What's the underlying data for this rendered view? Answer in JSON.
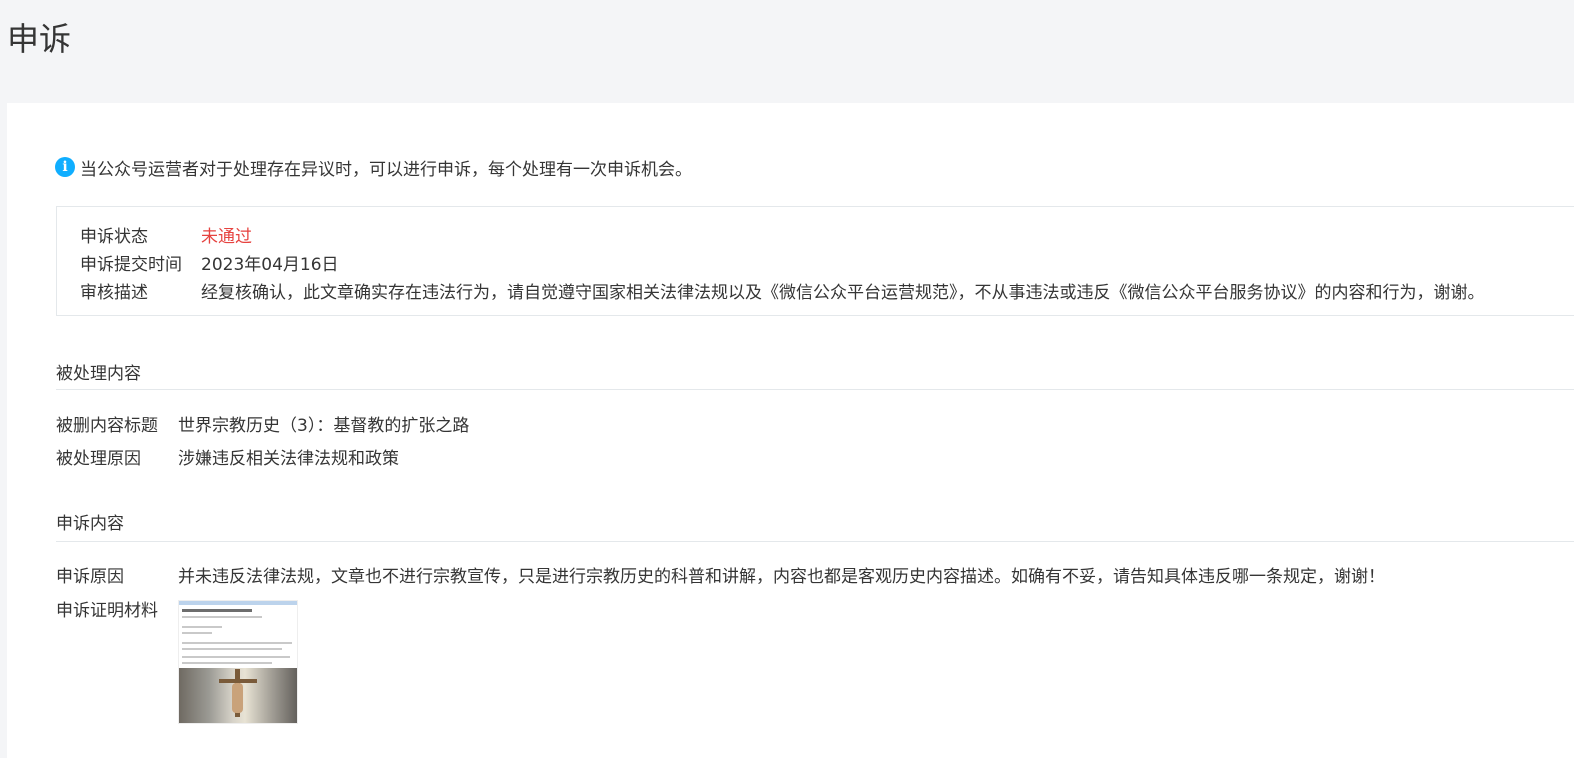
{
  "page": {
    "title": "申诉"
  },
  "notice": {
    "icon": "info-icon",
    "text": "当公众号运营者对于处理存在异议时，可以进行申诉，每个处理有一次申诉机会。"
  },
  "status": {
    "status_label": "申诉状态",
    "status_value": "未通过",
    "status_color": "#e64340",
    "time_label": "申诉提交时间",
    "time_value": "2023年04月16日",
    "desc_label": "审核描述",
    "desc_value": "经复核确认，此文章确实存在违法行为，请自觉遵守国家相关法律法规以及《微信公众平台运营规范》，不从事违法或违反《微信公众平台服务协议》的内容和行为，谢谢。"
  },
  "handled": {
    "section_title": "被处理内容",
    "title_label": "被删内容标题",
    "title_value": "世界宗教历史（3）：基督教的扩张之路",
    "reason_label": "被处理原因",
    "reason_value": "涉嫌违反相关法律法规和政策"
  },
  "appeal": {
    "section_title": "申诉内容",
    "reason_label": "申诉原因",
    "reason_value": "并未违反法律法规，文章也不进行宗教宣传，只是进行宗教历史的科普和讲解，内容也都是客观历史内容描述。如确有不妥，请告知具体违反哪一条规定，谢谢！",
    "evidence_label": "申诉证明材料"
  },
  "colors": {
    "accent": "#10aeff",
    "background": "#f4f5f7",
    "border": "#e4e8eb"
  }
}
